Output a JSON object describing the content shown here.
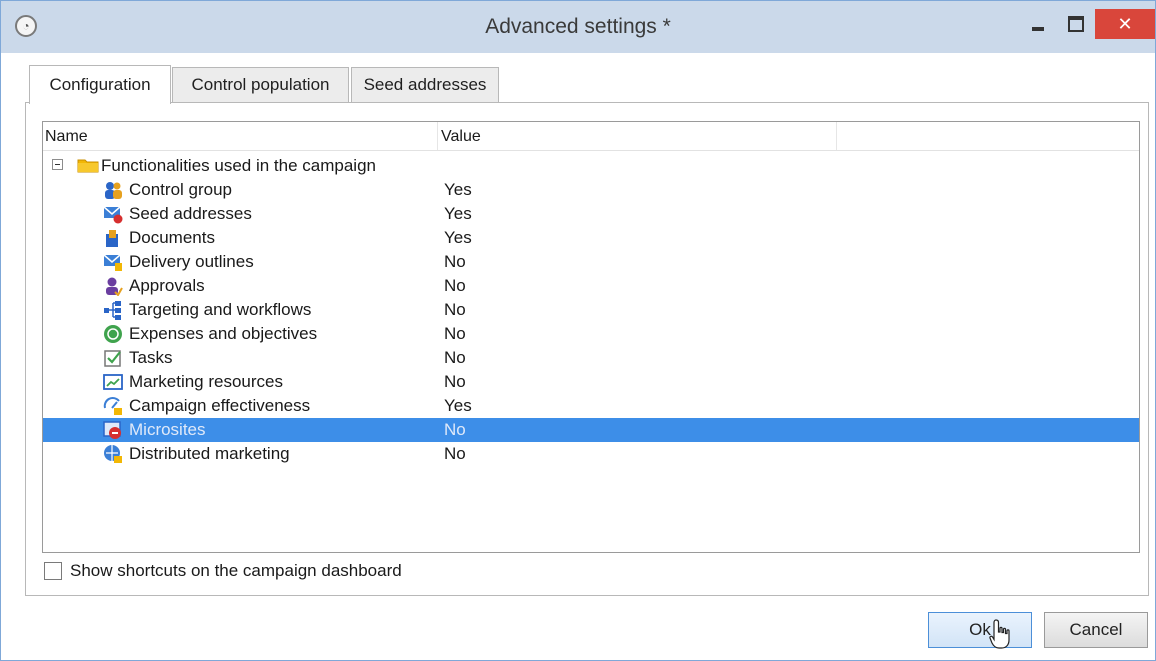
{
  "window": {
    "title": "Advanced settings *",
    "close_glyph": "✕"
  },
  "tabs": [
    {
      "label": "Configuration",
      "active": true
    },
    {
      "label": "Control population",
      "active": false
    },
    {
      "label": "Seed addresses",
      "active": false
    }
  ],
  "tree": {
    "columns": {
      "name": "Name",
      "value": "Value"
    },
    "root": {
      "label": "Functionalities used in the campaign",
      "icon": "folder-icon",
      "expanded": true
    },
    "items": [
      {
        "label": "Control group",
        "value": "Yes",
        "icon": "control-group-icon"
      },
      {
        "label": "Seed addresses",
        "value": "Yes",
        "icon": "seed-addresses-icon"
      },
      {
        "label": "Documents",
        "value": "Yes",
        "icon": "documents-icon"
      },
      {
        "label": "Delivery outlines",
        "value": "No",
        "icon": "delivery-outlines-icon"
      },
      {
        "label": "Approvals",
        "value": "No",
        "icon": "approvals-icon"
      },
      {
        "label": "Targeting and workflows",
        "value": "No",
        "icon": "targeting-workflows-icon"
      },
      {
        "label": "Expenses and objectives",
        "value": "No",
        "icon": "expenses-objectives-icon"
      },
      {
        "label": "Tasks",
        "value": "No",
        "icon": "tasks-icon"
      },
      {
        "label": "Marketing resources",
        "value": "No",
        "icon": "marketing-resources-icon"
      },
      {
        "label": "Campaign effectiveness",
        "value": "Yes",
        "icon": "campaign-effectiveness-icon"
      },
      {
        "label": "Microsites",
        "value": "No",
        "icon": "microsites-icon",
        "selected": true
      },
      {
        "label": "Distributed marketing",
        "value": "No",
        "icon": "distributed-marketing-icon"
      }
    ]
  },
  "shortcut": {
    "label": "Show shortcuts on the campaign dashboard",
    "checked": false
  },
  "buttons": {
    "ok": "Ok",
    "cancel": "Cancel"
  },
  "colors": {
    "selection": "#3d8ee8",
    "titlebar": "#cbd9ea",
    "close": "#d9463b"
  }
}
